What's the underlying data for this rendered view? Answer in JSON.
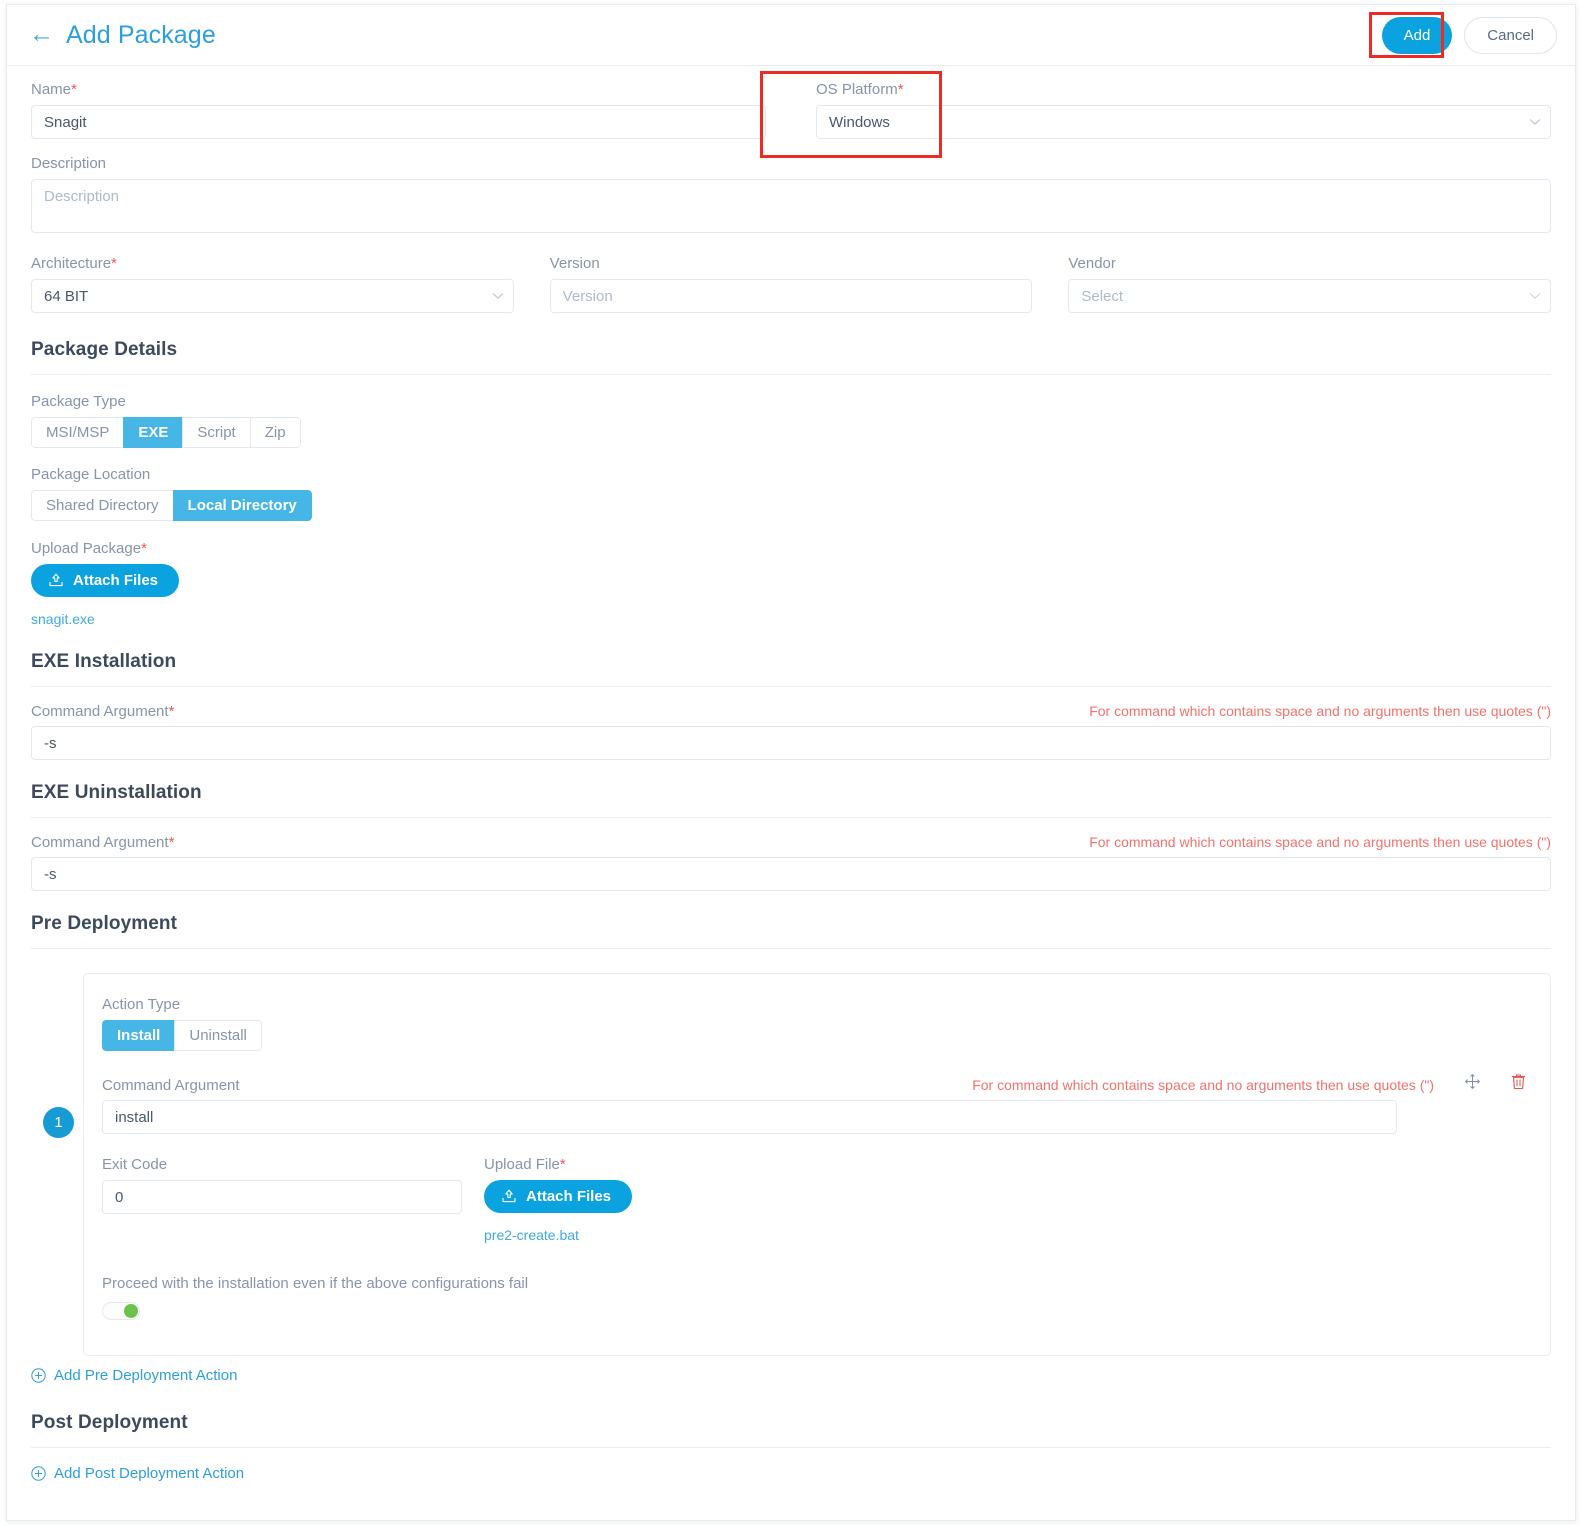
{
  "header": {
    "back_icon": "arrow-left-icon",
    "title": "Add Package",
    "add_label": "Add",
    "cancel_label": "Cancel"
  },
  "form": {
    "name": {
      "label": "Name",
      "required": "*",
      "value": "Snagit"
    },
    "os_platform": {
      "label": "OS Platform",
      "required": "*",
      "value": "Windows",
      "icon": "chevron-down-icon"
    },
    "description": {
      "label": "Description",
      "value": "",
      "placeholder": "Description"
    },
    "architecture": {
      "label": "Architecture",
      "required": "*",
      "value": "64 BIT",
      "icon": "chevron-down-icon"
    },
    "version": {
      "label": "Version",
      "value": "",
      "placeholder": "Version"
    },
    "vendor": {
      "label": "Vendor",
      "value": "",
      "placeholder": "Select",
      "icon": "chevron-down-icon"
    }
  },
  "package_details": {
    "title": "Package Details",
    "package_type": {
      "label": "Package Type",
      "options": [
        "MSI/MSP",
        "EXE",
        "Script",
        "Zip"
      ],
      "selected": "EXE"
    },
    "package_location": {
      "label": "Package Location",
      "options": [
        "Shared Directory",
        "Local Directory"
      ],
      "selected": "Local Directory"
    },
    "upload_package": {
      "label": "Upload Package",
      "required": "*",
      "button_label": "Attach Files",
      "icon": "upload-icon",
      "file": "snagit.exe"
    }
  },
  "exe_installation": {
    "title": "EXE Installation",
    "command_argument": {
      "label": "Command Argument",
      "required": "*",
      "value": "-s",
      "hint": "For command which contains space and no arguments then use quotes (\")"
    }
  },
  "exe_uninstallation": {
    "title": "EXE Uninstallation",
    "command_argument": {
      "label": "Command Argument",
      "required": "*",
      "value": "-s",
      "hint": "For command which contains space and no arguments then use quotes (\")"
    }
  },
  "pre_deployment": {
    "title": "Pre Deployment",
    "add_action_label": "Add Pre Deployment Action",
    "add_icon": "plus-circle-icon",
    "action": {
      "index": "1",
      "action_type": {
        "label": "Action Type",
        "options": [
          "Install",
          "Uninstall"
        ],
        "selected": "Install"
      },
      "command_argument": {
        "label": "Command Argument",
        "value": "install",
        "hint": "For command which contains space and no arguments then use quotes (\")"
      },
      "exit_code": {
        "label": "Exit Code",
        "value": "0"
      },
      "upload_file": {
        "label": "Upload File",
        "required": "*",
        "button_label": "Attach Files",
        "icon": "upload-icon",
        "file": "pre2-create.bat"
      },
      "proceed_toggle": {
        "label": "Proceed with the installation even if the above configurations fail",
        "state": "on"
      },
      "move_icon": "move-icon",
      "delete_icon": "trash-icon"
    }
  },
  "post_deployment": {
    "title": "Post Deployment",
    "add_action_label": "Add Post Deployment Action",
    "add_icon": "plus-circle-icon"
  },
  "colors": {
    "accent": "#2c9fe0",
    "toggle_active": "#45b6e5",
    "button_blue": "#0ba2e0",
    "hint_red": "#f4726c",
    "required_red": "#f0564f",
    "highlight_red": "#ee2a24",
    "switch_green": "#6cc24a"
  }
}
